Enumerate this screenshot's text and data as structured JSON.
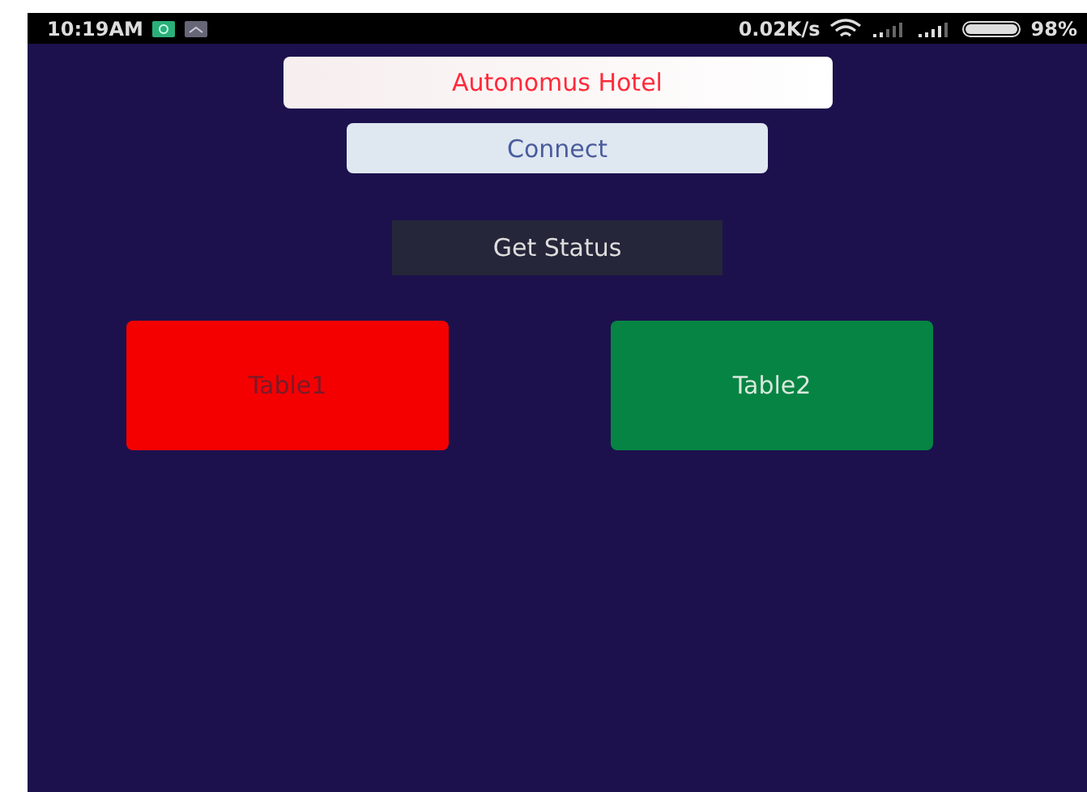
{
  "status_bar": {
    "time": "10:19AM",
    "speed": "0.02K/s",
    "battery": "98%"
  },
  "title": "Autonomus Hotel",
  "connect_button": "Connect",
  "status_button": "Get Status",
  "tables": [
    {
      "label": "Table1",
      "color": "#f50000"
    },
    {
      "label": "Table2",
      "color": "#068443"
    }
  ]
}
